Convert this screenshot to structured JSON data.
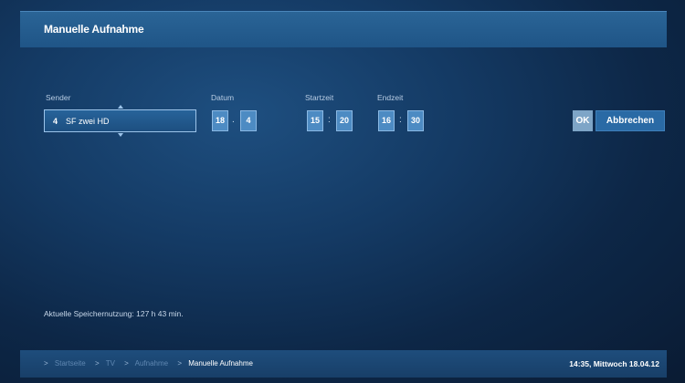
{
  "header": {
    "title": "Manuelle Aufnahme"
  },
  "form": {
    "channel": {
      "label": "Sender",
      "number": "4",
      "name": "SF zwei HD"
    },
    "date": {
      "label": "Datum",
      "day": "18",
      "month": "4",
      "separator": "."
    },
    "start": {
      "label": "Startzeit",
      "hour": "15",
      "minute": "20",
      "separator": ":"
    },
    "end": {
      "label": "Endzeit",
      "hour": "16",
      "minute": "30",
      "separator": ":"
    }
  },
  "buttons": {
    "ok": "OK",
    "cancel": "Abbrechen"
  },
  "storage": {
    "text": "Aktuelle Speichernutzung: 127 h 43 min."
  },
  "breadcrumb": {
    "items": [
      "Startseite",
      "TV",
      "Aufnahme",
      "Manuelle Aufnahme"
    ],
    "arrow": ">"
  },
  "status": {
    "datetime": "14:35, Mittwoch 18.04.12"
  },
  "colors": {
    "header": "#2a6496",
    "field": "#4d8bc3",
    "ok_button": "#7ea5c7",
    "cancel_button": "#2a6aa5"
  }
}
